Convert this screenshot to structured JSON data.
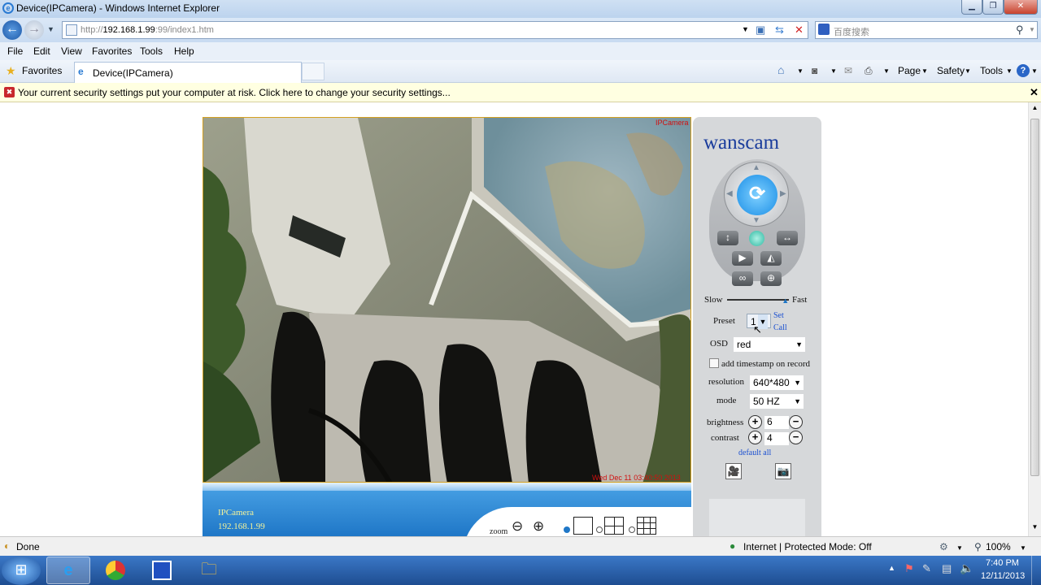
{
  "window": {
    "title": "Device(IPCamera) - Windows Internet Explorer"
  },
  "address": {
    "prefix": "http://",
    "host": "192.168.1.99",
    "rest": ":99/index1.htm"
  },
  "search": {
    "placeholder": "百度搜索"
  },
  "menu": {
    "items": [
      "File",
      "Edit",
      "View",
      "Favorites",
      "Tools",
      "Help"
    ]
  },
  "favorites": {
    "label": "Favorites",
    "tab_title": "Device(IPCamera)"
  },
  "command_bar": {
    "page": "Page",
    "safety": "Safety",
    "tools": "Tools"
  },
  "infobar": {
    "text": "Your current security settings put your computer at risk. Click here to change your security settings..."
  },
  "video": {
    "overlay_name": "IPCamera",
    "timestamp": "Wed Dec 11 03:40:50 2013"
  },
  "footer": {
    "camera_name": "IPCamera",
    "camera_ip": "192.168.1.99",
    "zoom_label": "zoom"
  },
  "panel": {
    "brand": "wanscam",
    "speed": {
      "slow": "Slow",
      "fast": "Fast",
      "value": 0.95
    },
    "preset": {
      "label": "Preset",
      "value": "1",
      "set": "Set",
      "call": "Call"
    },
    "osd": {
      "label": "OSD",
      "value": "red"
    },
    "timestamp_checkbox": {
      "label": "add timestamp on record",
      "checked": false
    },
    "resolution": {
      "label": "resolution",
      "value": "640*480"
    },
    "mode": {
      "label": "mode",
      "value": "50 HZ"
    },
    "brightness": {
      "label": "brightness",
      "value": "6"
    },
    "contrast": {
      "label": "contrast",
      "value": "4"
    },
    "default_all": "default all"
  },
  "status": {
    "left": "Done",
    "zone": "Internet | Protected Mode: Off",
    "zoom": "100%"
  },
  "taskbar": {
    "time": "7:40 PM",
    "date": "12/11/2013"
  },
  "colors": {
    "accent": "#1f77c7",
    "link": "#1a4fd0",
    "osd_red": "#d01010"
  }
}
